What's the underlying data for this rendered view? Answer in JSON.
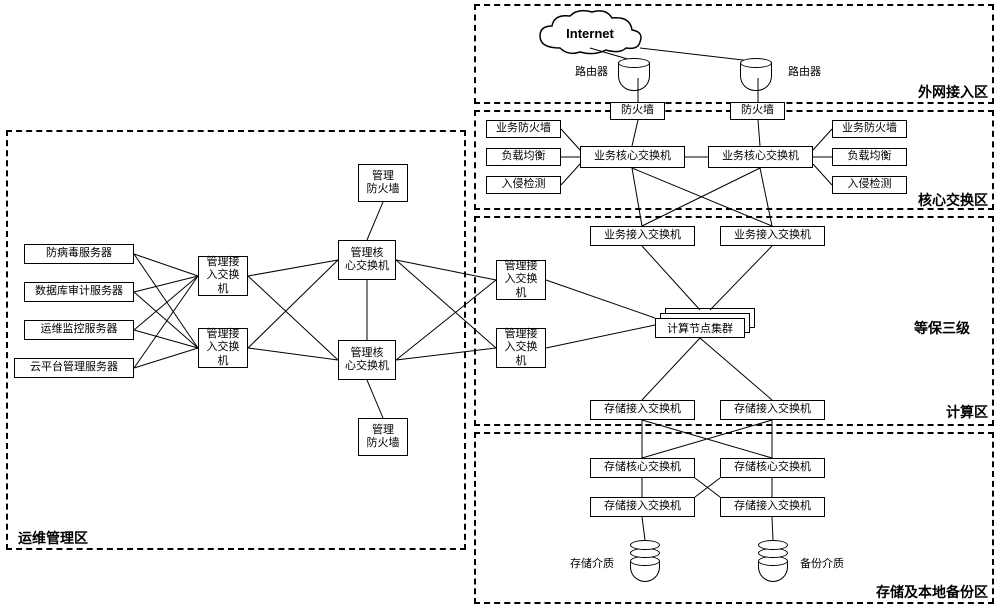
{
  "zones": {
    "external": "外网接入区",
    "core": "核心交换区",
    "compute": "计算区",
    "storage": "存储及本地备份区",
    "ops": "运维管理区"
  },
  "level3": "等保三级",
  "internet": "Internet",
  "router": "路由器",
  "firewall": "防火墙",
  "biz_firewall": "业务防火墙",
  "load_balance": "负载均衡",
  "intrusion": "入侵检测",
  "biz_core_switch": "业务核心交换机",
  "biz_access_switch": "业务接入交换机",
  "compute_cluster": "计算节点集群",
  "storage_access_switch": "存储接入交换机",
  "storage_core_switch": "存储核心交换机",
  "storage_media": "存储介质",
  "backup_media": "备份介质",
  "mgmt_firewall": "管理\n防火墙",
  "mgmt_core_switch": "管理核\n心交换机",
  "mgmt_access_switch": "管理接\n入交换机",
  "antivirus": "防病毒服务器",
  "db_audit": "数据库审计服务器",
  "ops_monitor": "运维监控服务器",
  "cloud_mgmt": "云平台管理服务器"
}
